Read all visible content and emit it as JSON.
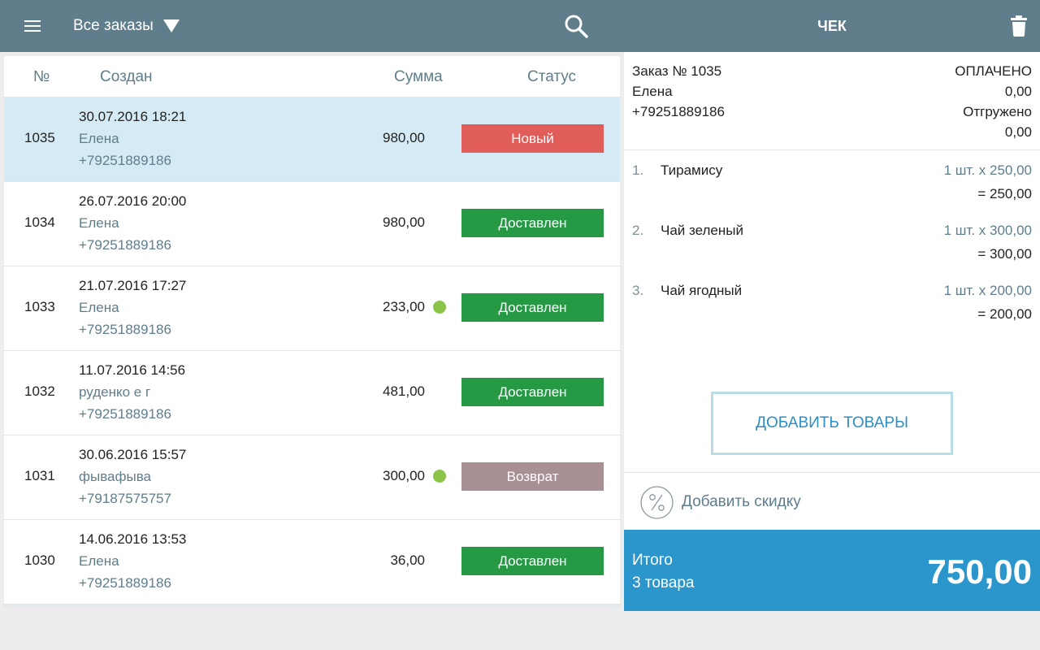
{
  "header": {
    "filter_label": "Все заказы",
    "receipt_title": "ЧЕК"
  },
  "orders": {
    "columns": {
      "number": "№",
      "created": "Создан",
      "amount": "Сумма",
      "status": "Статус"
    },
    "rows": [
      {
        "number": "1035",
        "date": "30.07.2016 18:21",
        "name": "Елена",
        "phone": "+79251889186",
        "amount": "980,00",
        "indicator": false,
        "status": "Новый",
        "status_color": "#e05d59",
        "selected": true
      },
      {
        "number": "1034",
        "date": "26.07.2016 20:00",
        "name": "Елена",
        "phone": "+79251889186",
        "amount": "980,00",
        "indicator": false,
        "status": "Доставлен",
        "status_color": "#259944",
        "selected": false
      },
      {
        "number": "1033",
        "date": "21.07.2016 17:27",
        "name": "Елена",
        "phone": "+79251889186",
        "amount": "233,00",
        "indicator": true,
        "status": "Доставлен",
        "status_color": "#259944",
        "selected": false
      },
      {
        "number": "1032",
        "date": "11.07.2016 14:56",
        "name": "руденко е г",
        "phone": "+79251889186",
        "amount": "481,00",
        "indicator": false,
        "status": "Доставлен",
        "status_color": "#259944",
        "selected": false
      },
      {
        "number": "1031",
        "date": "30.06.2016 15:57",
        "name": "фывафыва",
        "phone": "+79187575757",
        "amount": "300,00",
        "indicator": true,
        "status": "Возврат",
        "status_color": "#a89095",
        "selected": false
      },
      {
        "number": "1030",
        "date": "14.06.2016 13:53",
        "name": "Елена",
        "phone": "+79251889186",
        "amount": "36,00",
        "indicator": false,
        "status": "Доставлен",
        "status_color": "#259944",
        "selected": false
      }
    ]
  },
  "receipt": {
    "order_title": "Заказ № 1035",
    "payment_status": "ОПЛАЧЕНО",
    "customer_name": "Елена",
    "paid_amount": "0,00",
    "customer_phone": "+79251889186",
    "shipment_status": "Отгружено",
    "shipped_amount": "0,00",
    "items": [
      {
        "index": "1.",
        "name": "Тирамису",
        "qty_price": "1 шт. х 250,00",
        "total": "= 250,00"
      },
      {
        "index": "2.",
        "name": "Чай зеленый",
        "qty_price": "1 шт. х 300,00",
        "total": "= 300,00"
      },
      {
        "index": "3.",
        "name": "Чай ягодный",
        "qty_price": "1 шт. х 200,00",
        "total": "= 200,00"
      }
    ],
    "add_items_label": "ДОБАВИТЬ ТОВАРЫ",
    "discount_label": "Добавить скидку",
    "total_label": "Итого",
    "items_count": "3 товара",
    "total_amount": "750,00"
  },
  "icons": {
    "menu": "menu-icon",
    "filter_caret": "caret-down-icon",
    "search": "search-icon",
    "trash": "trash-icon",
    "discount": "percent-icon",
    "indicator": "green-dot-icon"
  },
  "colors": {
    "toolbar": "#5f7d8b",
    "selected_row": "#d4ebf6",
    "total_bar": "#2b96cc",
    "indicator": "#8bc34a"
  }
}
